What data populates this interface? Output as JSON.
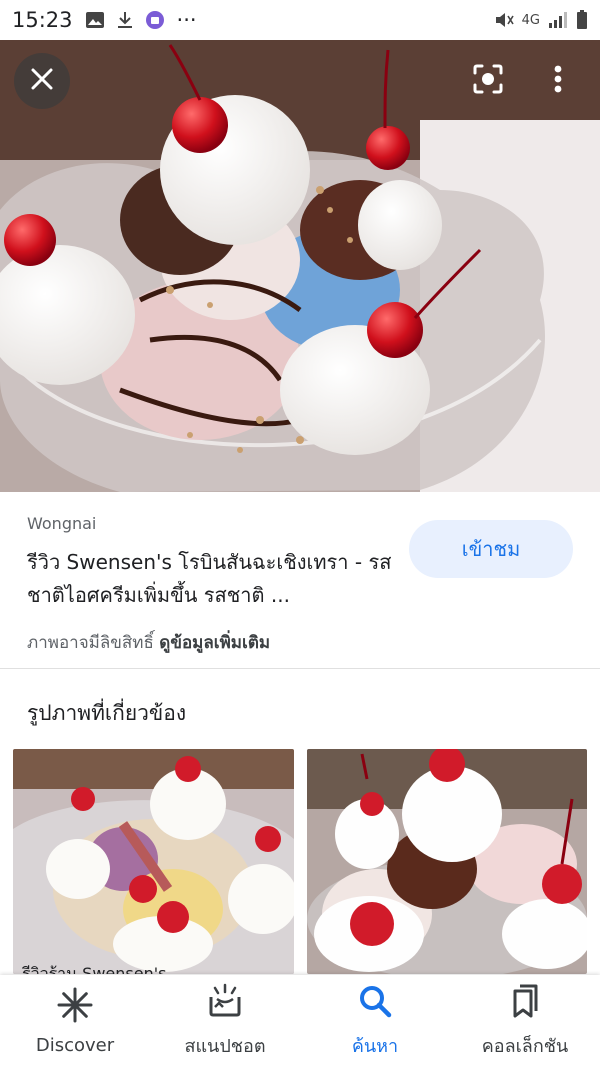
{
  "status_bar": {
    "time": "15:23",
    "more_indicator": "···",
    "network": "4G",
    "icons": [
      "gallery-icon",
      "download-icon",
      "app-notification-icon",
      "mute-icon",
      "signal-icon",
      "battery-icon"
    ]
  },
  "viewer": {
    "close_icon": "close-icon",
    "lens_icon": "lens-icon",
    "more_icon": "more-vert-icon"
  },
  "result": {
    "source": "Wongnai",
    "title": "รีวิว Swensen's โรบินสันฉะเชิงเทรา - รสชาติไอศครีมเพิ่มขึ้น รสชาติ ...",
    "visit_label": "เข้าชม",
    "copyright_text": "ภาพอาจมีลิขสิทธิ์",
    "learn_more": "ดูข้อมูลเพิ่มเติม"
  },
  "related": {
    "heading": "รูปภาพที่เกี่ยวข้อง",
    "first_caption": "รีวิวร้าน Swensen's"
  },
  "bottom_nav": {
    "items": [
      {
        "label": "Discover",
        "icon": "asterisk-icon"
      },
      {
        "label": "สแนปชอต",
        "icon": "snapshot-icon"
      },
      {
        "label": "ค้นหา",
        "icon": "search-icon"
      },
      {
        "label": "คอลเล็กชัน",
        "icon": "collections-icon"
      }
    ],
    "active_index": 2
  },
  "colors": {
    "accent": "#1a73e8",
    "visit_bg": "#e8f0fe",
    "secondary_text": "#5f6368"
  }
}
